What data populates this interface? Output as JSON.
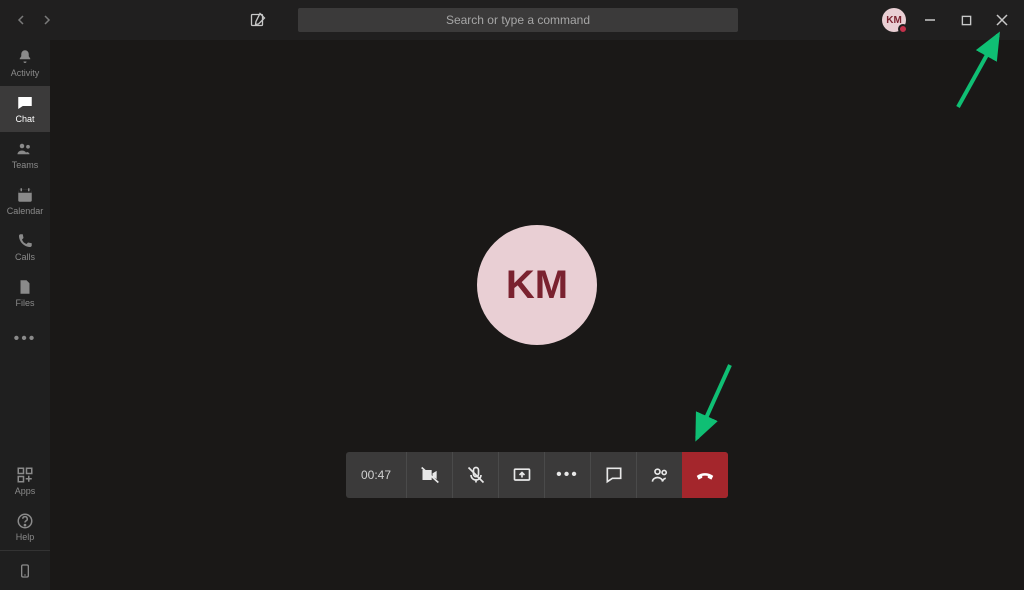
{
  "titlebar": {
    "search_placeholder": "Search or type a command",
    "avatar_initials": "KM"
  },
  "sidebar": {
    "items": [
      {
        "label": "Activity"
      },
      {
        "label": "Chat"
      },
      {
        "label": "Teams"
      },
      {
        "label": "Calendar"
      },
      {
        "label": "Calls"
      },
      {
        "label": "Files"
      }
    ],
    "bottom": [
      {
        "label": "Apps"
      },
      {
        "label": "Help"
      }
    ]
  },
  "call": {
    "participant_initials": "KM",
    "duration": "00:47"
  },
  "colors": {
    "bg": "#201f1f",
    "sidebar": "#1f1f1f",
    "toolbar": "#3b3a3a",
    "hangup": "#a4262c",
    "avatar_bg": "#e9cfd4",
    "avatar_fg": "#7a222f",
    "arrow": "#0fbf74"
  }
}
